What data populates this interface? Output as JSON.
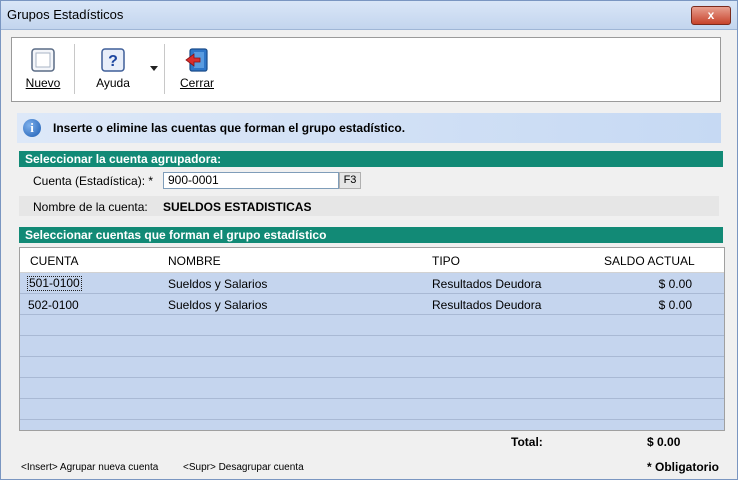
{
  "window": {
    "title": "Grupos Estadísticos",
    "close_label": "x"
  },
  "toolbar": {
    "new_label": "Nuevo",
    "help_label": "Ayuda",
    "close_label": "Cerrar"
  },
  "info": {
    "text": "Inserte o elimine las cuentas que forman el grupo estadístico."
  },
  "section_account": {
    "header": "Seleccionar la cuenta agrupadora:",
    "cuenta_label": "Cuenta (Estadística): *",
    "cuenta_value": "900-0001",
    "f3_label": "F3",
    "nombre_label": "Nombre de la cuenta:",
    "nombre_value": "SUELDOS ESTADISTICAS"
  },
  "section_group": {
    "header": "Seleccionar cuentas que forman el grupo estadístico",
    "columns": {
      "cuenta": "CUENTA",
      "nombre": "NOMBRE",
      "tipo": "TIPO",
      "saldo": "SALDO ACTUAL"
    },
    "rows": [
      {
        "cuenta": "501-0100",
        "nombre": "Sueldos y Salarios",
        "tipo": "Resultados Deudora",
        "saldo": "$ 0.00"
      },
      {
        "cuenta": "502-0100",
        "nombre": "Sueldos y Salarios",
        "tipo": "Resultados Deudora",
        "saldo": "$ 0.00"
      }
    ],
    "empty_row_count": 6
  },
  "footer": {
    "total_label": "Total:",
    "total_value": "$ 0.00",
    "hint_insert": "<Insert> Agrupar nueva cuenta",
    "hint_supr": "<Supr> Desagrupar cuenta",
    "required_note": "* Obligatorio"
  },
  "colors": {
    "section_header": "#128a76",
    "row_fill": "#c5d5ee",
    "info_bg": "#c6d9f3"
  },
  "icons": [
    "new-document-icon",
    "help-icon",
    "dropdown-arrow-icon",
    "exit-door-icon",
    "info-icon",
    "close-icon"
  ]
}
